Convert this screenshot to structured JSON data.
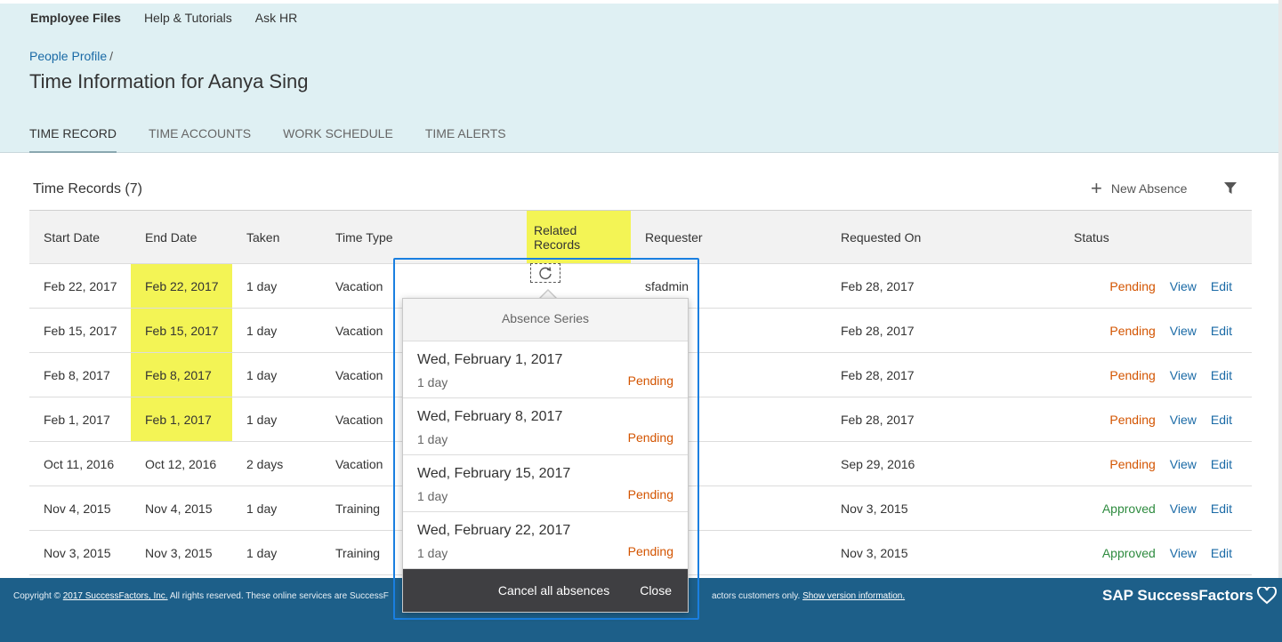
{
  "topnav": [
    "Employee Files",
    "Help & Tutorials",
    "Ask HR"
  ],
  "breadcrumb": {
    "link": "People Profile",
    "sep": "/"
  },
  "page_title": "Time Information for Aanya Sing",
  "tabs": [
    "TIME RECORD",
    "TIME ACCOUNTS",
    "WORK SCHEDULE",
    "TIME ALERTS"
  ],
  "section": {
    "title": "Time Records (7)",
    "new_absence": "New Absence"
  },
  "columns": [
    "Start Date",
    "End Date",
    "Taken",
    "Time Type",
    "Related Records",
    "Requester",
    "Requested On",
    "Status"
  ],
  "rows": [
    {
      "start": "Feb 22, 2017",
      "end": "Feb 22, 2017",
      "taken": "1 day",
      "type": "Vacation",
      "requester": "sfadmin",
      "requested_on": "Feb 28, 2017",
      "status": "Pending"
    },
    {
      "start": "Feb 15, 2017",
      "end": "Feb 15, 2017",
      "taken": "1 day",
      "type": "Vacation",
      "requester": "",
      "requested_on": "Feb 28, 2017",
      "status": "Pending"
    },
    {
      "start": "Feb 8, 2017",
      "end": "Feb 8, 2017",
      "taken": "1 day",
      "type": "Vacation",
      "requester": "",
      "requested_on": "Feb 28, 2017",
      "status": "Pending"
    },
    {
      "start": "Feb 1, 2017",
      "end": "Feb 1, 2017",
      "taken": "1 day",
      "type": "Vacation",
      "requester": "",
      "requested_on": "Feb 28, 2017",
      "status": "Pending"
    },
    {
      "start": "Oct 11, 2016",
      "end": "Oct 12, 2016",
      "taken": "2 days",
      "type": "Vacation",
      "requester": "",
      "requested_on": "Sep 29, 2016",
      "status": "Pending"
    },
    {
      "start": "Nov 4, 2015",
      "end": "Nov 4, 2015",
      "taken": "1 day",
      "type": "Training",
      "requester": "",
      "requested_on": "Nov 3, 2015",
      "status": "Approved"
    },
    {
      "start": "Nov 3, 2015",
      "end": "Nov 3, 2015",
      "taken": "1 day",
      "type": "Training",
      "requester": "",
      "requested_on": "Nov 3, 2015",
      "status": "Approved"
    }
  ],
  "row_links": {
    "view": "View",
    "edit": "Edit"
  },
  "popover": {
    "title": "Absence Series",
    "items": [
      {
        "date": "Wed, February 1, 2017",
        "duration": "1 day",
        "status": "Pending"
      },
      {
        "date": "Wed, February 8, 2017",
        "duration": "1 day",
        "status": "Pending"
      },
      {
        "date": "Wed, February 15, 2017",
        "duration": "1 day",
        "status": "Pending"
      },
      {
        "date": "Wed, February 22, 2017",
        "duration": "1 day",
        "status": "Pending"
      }
    ],
    "cancel_all": "Cancel all absences",
    "close": "Close"
  },
  "footer": {
    "copyright_prefix": "Copyright ©",
    "copyright_link": "2017 SuccessFactors, Inc.",
    "copyright_text": "All rights reserved. These online services are SuccessF",
    "copyright_text_right": "actors customers only.",
    "version_link": "Show version information.",
    "brand": "SAP SuccessFactors"
  },
  "colors": {
    "header_bg": "#dff0f3",
    "footer_bg": "#1d5f89",
    "highlight": "#f3f455",
    "pending": "#d35400",
    "approved": "#2e8b3f",
    "link": "#1a6aa6",
    "focus": "#1a7fe0"
  },
  "icons": {
    "add": "plus-icon",
    "filter": "filter-icon",
    "related": "refresh-icon",
    "brand": "heart-icon"
  }
}
